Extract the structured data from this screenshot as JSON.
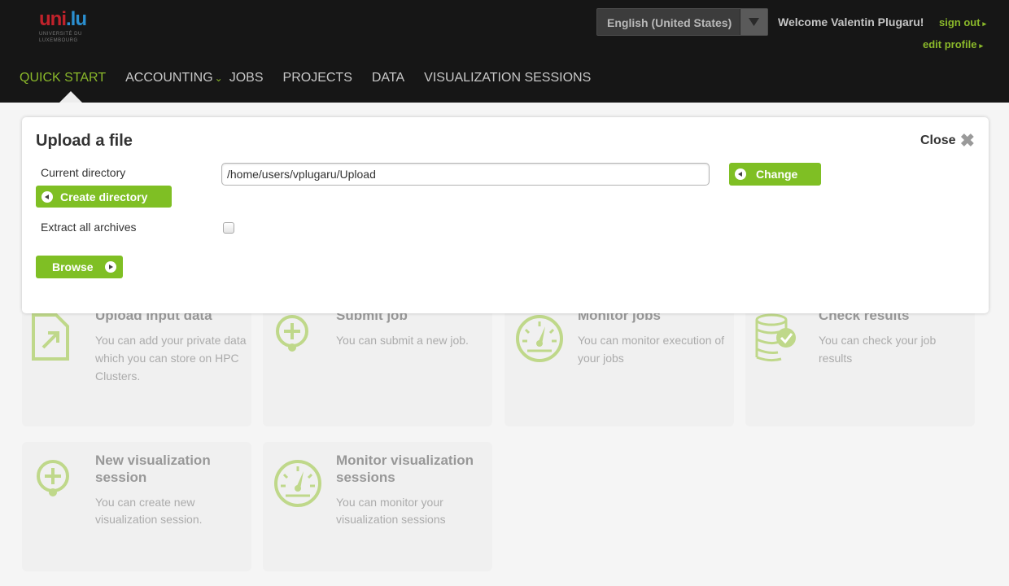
{
  "header": {
    "logo_text_red": "uni",
    "logo_text_blue": ".lu",
    "logo_subtitle": "UNIVERSITÉ DU LUXEMBOURG",
    "language": "English (United States)",
    "welcome": "Welcome Valentin Plugaru!",
    "sign_out": "sign out",
    "edit_profile": "edit profile",
    "link_color": "#8ab82a"
  },
  "nav": {
    "items": [
      {
        "label": "QUICK START",
        "active": true
      },
      {
        "label": "ACCOUNTING",
        "has_dropdown": true
      },
      {
        "label": "JOBS"
      },
      {
        "label": "PROJECTS"
      },
      {
        "label": "DATA"
      },
      {
        "label": "VISUALIZATION SESSIONS"
      }
    ]
  },
  "tiles": [
    {
      "title": "Upload input data",
      "desc": "You can add your private data which you can store on HPC Clusters.",
      "icon": "upload-file-icon"
    },
    {
      "title": "Submit job",
      "desc": "You can submit a new job.",
      "icon": "add-circle-icon"
    },
    {
      "title": "Monitor jobs",
      "desc": "You can monitor execution of your jobs",
      "icon": "gauge-icon"
    },
    {
      "title": "Check results",
      "desc": "You can check your job results",
      "icon": "database-check-icon"
    },
    {
      "title": "New visualization session",
      "desc": "You can create new visualization session.",
      "icon": "add-circle-icon"
    },
    {
      "title": "Monitor visualization sessions",
      "desc": "You can monitor your visualization sessions",
      "icon": "gauge-icon"
    }
  ],
  "dialog": {
    "title": "Upload a file",
    "close": "Close",
    "current_directory_label": "Current directory",
    "current_directory_value": "/home/users/vplugaru/Upload",
    "change_button": "Change",
    "create_directory_button": "Create directory",
    "extract_archives_label": "Extract all archives",
    "extract_archives_checked": false,
    "browse_button": "Browse",
    "accent_color": "#7fbf24"
  }
}
